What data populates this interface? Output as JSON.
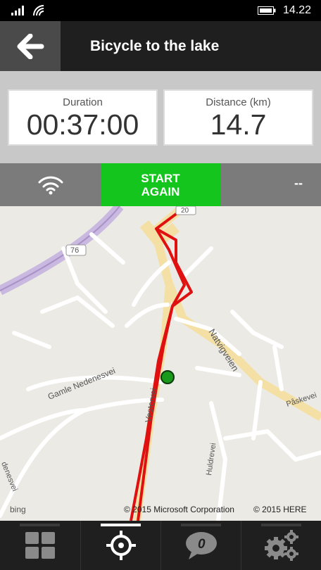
{
  "status_bar": {
    "time": "14.22",
    "icons": [
      "signal-icon",
      "wifi-icon",
      "battery-icon"
    ]
  },
  "header": {
    "title": "Bicycle to the lake",
    "back_icon": "arrow-left-icon"
  },
  "stats": {
    "duration_label": "Duration",
    "duration_value": "00:37:00",
    "distance_label": "Distance (km)",
    "distance_value": "14.7"
  },
  "controls": {
    "gps_icon": "gps-signal-icon",
    "start_label_line1": "START",
    "start_label_line2": "AGAIN",
    "right_value": "--"
  },
  "map": {
    "road_labels": [
      "76",
      "20",
      "Natvigveien",
      "Gamle Nedenesvei",
      "Vestervei",
      "Huldrevei",
      "Påskevei",
      "denesvei"
    ],
    "attribution_bing": "bing",
    "attribution_microsoft": "© 2015 Microsoft Corporation",
    "attribution_here": "© 2015 HERE",
    "route_color": "#e01010",
    "position_color": "#1a9a1a"
  },
  "bottom_nav": {
    "items": [
      "grid-icon",
      "locate-icon",
      "comment-icon",
      "settings-icon"
    ],
    "comment_count": "0",
    "active_index": 1
  },
  "colors": {
    "accent_green": "#13c51c",
    "header_bg": "#1f1f1f"
  }
}
